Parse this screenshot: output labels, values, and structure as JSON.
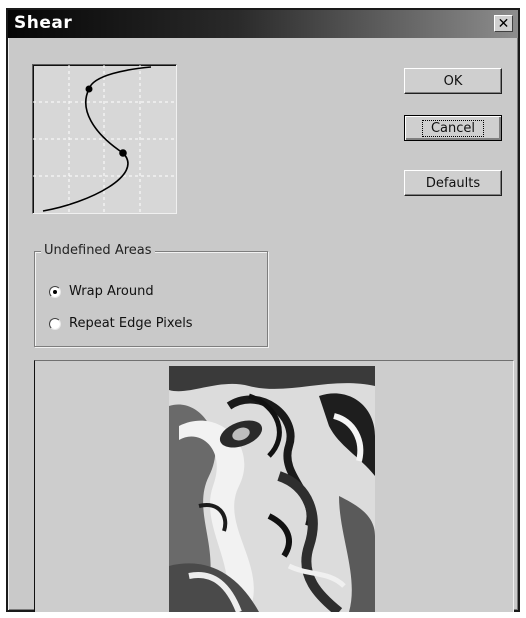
{
  "dialog": {
    "title": "Shear",
    "close_glyph": "✕"
  },
  "buttons": {
    "ok": "OK",
    "cancel": "Cancel",
    "defaults": "Defaults"
  },
  "undefined_areas": {
    "legend": "Undefined Areas",
    "options": [
      {
        "label": "Wrap Around",
        "selected": true
      },
      {
        "label": "Repeat Edge Pixels",
        "selected": false
      }
    ]
  },
  "icons": {
    "close": "close-icon",
    "curve": "shear-curve-graph",
    "preview": "distorted-face-preview"
  },
  "colors": {
    "window_bg": "#c9c9c9",
    "title_bar": "#060606",
    "grid": "#ffffff",
    "curve": "#000000"
  }
}
